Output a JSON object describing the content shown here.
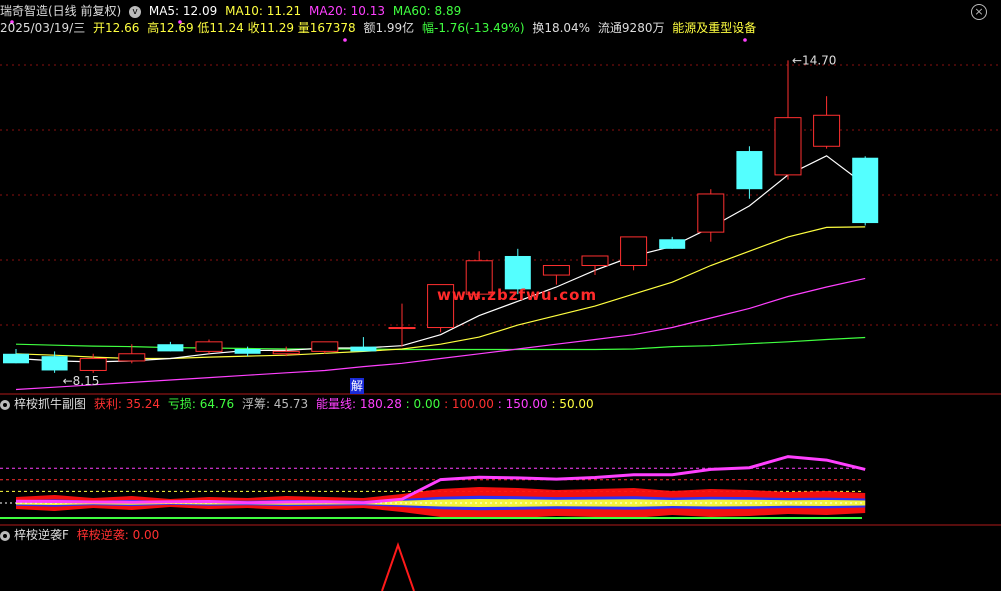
{
  "header": {
    "stock": "瑞奇智造(日线 前复权)",
    "ma5": "MA5: 12.09",
    "ma10": "MA10: 11.21",
    "ma20": "MA20: 10.13",
    "ma60": "MA60: 8.89",
    "date": "2025/03/19/三",
    "open": "开12.66",
    "high": "高12.69",
    "low": "低11.24",
    "close": "收11.29",
    "volume": "量167378",
    "amount": "额1.99亿",
    "change": "幅-1.76(-13.49%)",
    "turnover": "换18.04%",
    "float": "流通9280万",
    "sector": "能源及重型设备",
    "close_icon": "close-icon"
  },
  "colors": {
    "up": "#ff3030",
    "down": "#54ffff",
    "ma5": "#ffffff",
    "ma10": "#ffff40",
    "ma20": "#ff40ff",
    "ma60": "#40ff40"
  },
  "annotations": {
    "high_label": "14.70",
    "low_label": "8.15",
    "jie": "解",
    "watermark": "www.zbzfwu.com"
  },
  "indicator1": {
    "title": "梓桉抓牛副图",
    "profit": "获利: 35.24",
    "loss": "亏损: 64.76",
    "float": "浮筹: 45.73",
    "energy": "能量线: 180.28",
    "v0": ": 0.00",
    "v100": ": 100.00",
    "v150": ": 150.00",
    "v50": ": 50.00"
  },
  "indicator2": {
    "title": "梓桉逆袭F",
    "value": "梓桉逆袭: 0.00"
  },
  "chart_data": {
    "type": "candlestick",
    "candles": [
      {
        "o": 8.55,
        "h": 8.65,
        "l": 8.35,
        "c": 8.35
      },
      {
        "o": 8.5,
        "h": 8.6,
        "l": 8.15,
        "c": 8.2
      },
      {
        "o": 8.2,
        "h": 8.55,
        "l": 8.15,
        "c": 8.45
      },
      {
        "o": 8.4,
        "h": 8.75,
        "l": 8.35,
        "c": 8.55
      },
      {
        "o": 8.75,
        "h": 8.8,
        "l": 8.6,
        "c": 8.6
      },
      {
        "o": 8.6,
        "h": 8.85,
        "l": 8.55,
        "c": 8.8
      },
      {
        "o": 8.65,
        "h": 8.7,
        "l": 8.5,
        "c": 8.55
      },
      {
        "o": 8.55,
        "h": 8.7,
        "l": 8.5,
        "c": 8.6
      },
      {
        "o": 8.6,
        "h": 8.8,
        "l": 8.55,
        "c": 8.8
      },
      {
        "o": 8.7,
        "h": 8.9,
        "l": 8.6,
        "c": 8.6
      },
      {
        "o": 9.1,
        "h": 9.6,
        "l": 8.7,
        "c": 9.1
      },
      {
        "o": 9.1,
        "h": 10.0,
        "l": 9.0,
        "c": 10.0
      },
      {
        "o": 9.8,
        "h": 10.7,
        "l": 9.7,
        "c": 10.5
      },
      {
        "o": 10.6,
        "h": 10.75,
        "l": 9.8,
        "c": 9.9
      },
      {
        "o": 10.2,
        "h": 10.4,
        "l": 10.0,
        "c": 10.4
      },
      {
        "o": 10.4,
        "h": 10.6,
        "l": 10.2,
        "c": 10.6
      },
      {
        "o": 10.4,
        "h": 11.0,
        "l": 10.3,
        "c": 11.0
      },
      {
        "o": 10.95,
        "h": 11.0,
        "l": 10.75,
        "c": 10.75
      },
      {
        "o": 11.1,
        "h": 12.0,
        "l": 10.9,
        "c": 11.9
      },
      {
        "o": 12.8,
        "h": 12.9,
        "l": 11.8,
        "c": 12.0
      },
      {
        "o": 12.3,
        "h": 14.7,
        "l": 12.2,
        "c": 13.5
      },
      {
        "o": 12.9,
        "h": 13.95,
        "l": 12.85,
        "c": 13.55
      },
      {
        "o": 12.66,
        "h": 12.69,
        "l": 11.24,
        "c": 11.29
      }
    ],
    "ma5": [
      8.45,
      8.4,
      8.38,
      8.4,
      8.45,
      8.55,
      8.62,
      8.62,
      8.67,
      8.67,
      8.72,
      8.95,
      9.35,
      9.65,
      9.95,
      10.3,
      10.6,
      10.8,
      11.2,
      11.65,
      12.3,
      12.7,
      12.09
    ],
    "ma10": [
      8.55,
      8.52,
      8.48,
      8.45,
      8.45,
      8.48,
      8.5,
      8.52,
      8.56,
      8.6,
      8.65,
      8.75,
      8.9,
      9.15,
      9.35,
      9.55,
      9.8,
      10.05,
      10.4,
      10.7,
      11.0,
      11.2,
      11.21
    ],
    "ma20": [
      7.8,
      7.85,
      7.9,
      7.95,
      8.0,
      8.05,
      8.1,
      8.15,
      8.2,
      8.28,
      8.35,
      8.45,
      8.55,
      8.65,
      8.75,
      8.85,
      8.95,
      9.1,
      9.3,
      9.5,
      9.75,
      9.95,
      10.13
    ],
    "ma60": [
      8.75,
      8.73,
      8.71,
      8.7,
      8.68,
      8.67,
      8.66,
      8.65,
      8.65,
      8.65,
      8.64,
      8.64,
      8.64,
      8.64,
      8.64,
      8.64,
      8.65,
      8.7,
      8.72,
      8.76,
      8.8,
      8.85,
      8.89
    ],
    "energy_line": [
      72,
      71,
      69,
      68,
      70,
      71,
      66,
      69,
      70,
      66,
      81,
      101,
      111,
      108,
      103,
      110,
      122,
      122,
      145,
      152,
      200,
      185,
      145
    ]
  }
}
